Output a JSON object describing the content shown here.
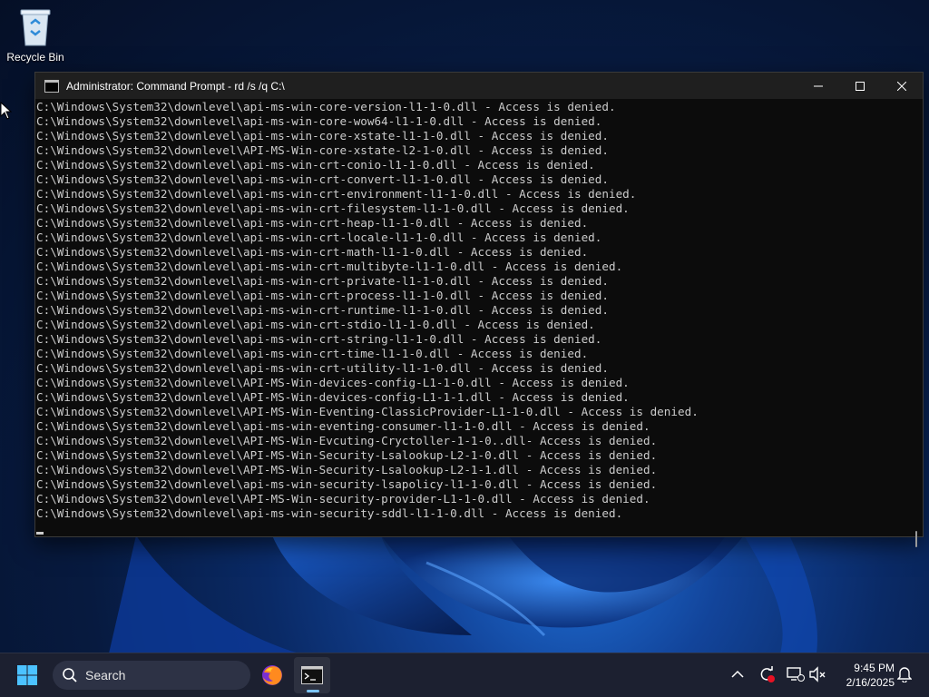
{
  "desktop": {
    "recycle_bin_label": "Recycle Bin"
  },
  "window": {
    "title": "Administrator: Command Prompt - rd  /s /q C:\\",
    "lines": [
      "C:\\Windows\\System32\\downlevel\\api-ms-win-core-version-l1-1-0.dll - Access is denied.",
      "C:\\Windows\\System32\\downlevel\\api-ms-win-core-wow64-l1-1-0.dll - Access is denied.",
      "C:\\Windows\\System32\\downlevel\\api-ms-win-core-xstate-l1-1-0.dll - Access is denied.",
      "C:\\Windows\\System32\\downlevel\\API-MS-Win-core-xstate-l2-1-0.dll - Access is denied.",
      "C:\\Windows\\System32\\downlevel\\api-ms-win-crt-conio-l1-1-0.dll - Access is denied.",
      "C:\\Windows\\System32\\downlevel\\api-ms-win-crt-convert-l1-1-0.dll - Access is denied.",
      "C:\\Windows\\System32\\downlevel\\api-ms-win-crt-environment-l1-1-0.dll - Access is denied.",
      "C:\\Windows\\System32\\downlevel\\api-ms-win-crt-filesystem-l1-1-0.dll - Access is denied.",
      "C:\\Windows\\System32\\downlevel\\api-ms-win-crt-heap-l1-1-0.dll - Access is denied.",
      "C:\\Windows\\System32\\downlevel\\api-ms-win-crt-locale-l1-1-0.dll - Access is denied.",
      "C:\\Windows\\System32\\downlevel\\api-ms-win-crt-math-l1-1-0.dll - Access is denied.",
      "C:\\Windows\\System32\\downlevel\\api-ms-win-crt-multibyte-l1-1-0.dll - Access is denied.",
      "C:\\Windows\\System32\\downlevel\\api-ms-win-crt-private-l1-1-0.dll - Access is denied.",
      "C:\\Windows\\System32\\downlevel\\api-ms-win-crt-process-l1-1-0.dll - Access is denied.",
      "C:\\Windows\\System32\\downlevel\\api-ms-win-crt-runtime-l1-1-0.dll - Access is denied.",
      "C:\\Windows\\System32\\downlevel\\api-ms-win-crt-stdio-l1-1-0.dll - Access is denied.",
      "C:\\Windows\\System32\\downlevel\\api-ms-win-crt-string-l1-1-0.dll - Access is denied.",
      "C:\\Windows\\System32\\downlevel\\api-ms-win-crt-time-l1-1-0.dll - Access is denied.",
      "C:\\Windows\\System32\\downlevel\\api-ms-win-crt-utility-l1-1-0.dll - Access is denied.",
      "C:\\Windows\\System32\\downlevel\\API-MS-Win-devices-config-L1-1-0.dll - Access is denied.",
      "C:\\Windows\\System32\\downlevel\\API-MS-Win-devices-config-L1-1-1.dll - Access is denied.",
      "C:\\Windows\\System32\\downlevel\\API-MS-Win-Eventing-ClassicProvider-L1-1-0.dll - Access is denied.",
      "C:\\Windows\\System32\\downlevel\\api-ms-win-eventing-consumer-l1-1-0.dll - Access is denied.",
      "C:\\Windows\\System32\\downlevel\\API-MS-Win-Evcuting-Cryctoller-1-1-0..dll- Access is denied.",
      "C:\\Windows\\System32\\downlevel\\API-MS-Win-Security-Lsalookup-L2-1-0.dll - Access is denied.",
      "C:\\Windows\\System32\\downlevel\\API-MS-Win-Security-Lsalookup-L2-1-1.dll - Access is denied.",
      "C:\\Windows\\System32\\downlevel\\api-ms-win-security-lsapolicy-l1-1-0.dll - Access is denied.",
      "C:\\Windows\\System32\\downlevel\\API-MS-Win-security-provider-L1-1-0.dll - Access is denied.",
      "C:\\Windows\\System32\\downlevel\\api-ms-win-security-sddl-l1-1-0.dll - Access is denied."
    ]
  },
  "taskbar": {
    "search_label": "Search",
    "apps": [
      "firefox-icon",
      "command-prompt-icon"
    ],
    "tray_icons": [
      "chevron-up-icon",
      "update-icon",
      "network-icon",
      "volume-muted-icon",
      "notification-bell-icon"
    ],
    "time": "9:45 PM",
    "date": "2/16/2025"
  },
  "colors": {
    "console_bg": "#0c0c0c",
    "console_text": "#cccccc",
    "taskbar_bg": "#1c2030",
    "accent": "#7cc4f8"
  }
}
